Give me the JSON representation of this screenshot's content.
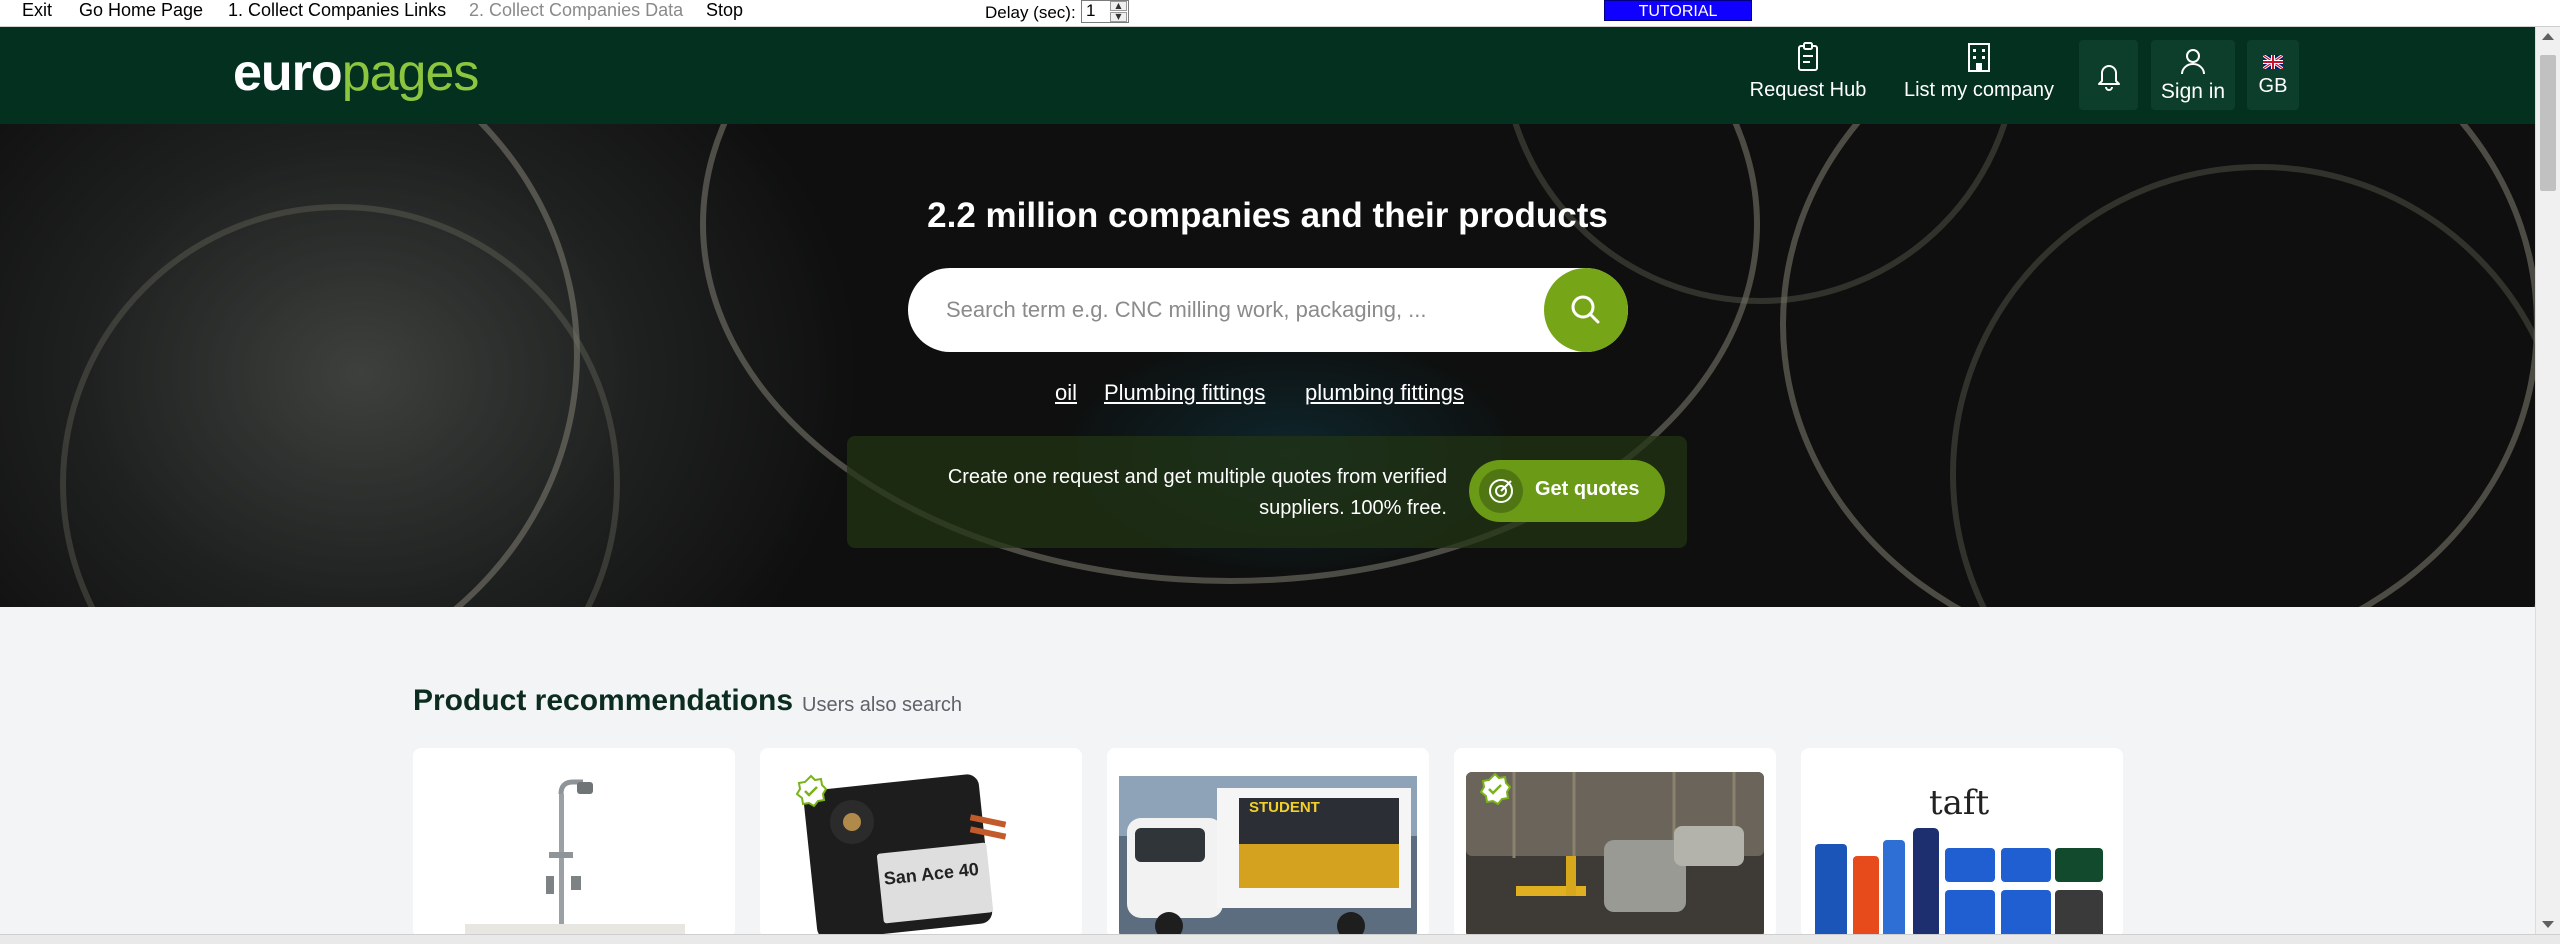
{
  "toolbar": {
    "items": [
      {
        "label": "Exit",
        "disabled": false
      },
      {
        "label": "Go Home Page",
        "disabled": false
      },
      {
        "label": "1. Collect Companies Links",
        "disabled": false
      },
      {
        "label": "2. Collect Companies Data",
        "disabled": true
      },
      {
        "label": "Stop",
        "disabled": false
      }
    ],
    "delay_label": "Delay (sec):",
    "delay_value": "1",
    "tutorial_label": "TUTORIAL",
    "tutorial_color": "#1000ff"
  },
  "header": {
    "logo_part1": "euro",
    "logo_part2": "pages",
    "brand_color": "#04301f",
    "accent_color": "#8cc63f",
    "nav": {
      "request_hub": "Request Hub",
      "list_company": "List my company",
      "sign_in": "Sign in",
      "language": "GB"
    }
  },
  "hero": {
    "title": "2.2 million companies and their products",
    "search_placeholder": "Search term e.g. CNC milling work, packaging, ...",
    "suggestions": [
      "oil",
      "Plumbing fittings",
      "plumbing fittings"
    ],
    "quote_text": "Create one request and get multiple quotes from verified suppliers. 100% free.",
    "quote_button": "Get quotes"
  },
  "recommendations": {
    "title": "Product recommendations",
    "subtitle": "Users also search",
    "cards": [
      {
        "image": "shower-fixture",
        "verified": false,
        "caption": ""
      },
      {
        "image": "cooling-fan",
        "verified": true,
        "caption": "San Ace 40"
      },
      {
        "image": "advertising-van",
        "verified": false,
        "caption": "STUDENT"
      },
      {
        "image": "industrial-machine",
        "verified": true,
        "caption": ""
      },
      {
        "image": "hair-products",
        "verified": false,
        "caption": "taft"
      }
    ]
  }
}
